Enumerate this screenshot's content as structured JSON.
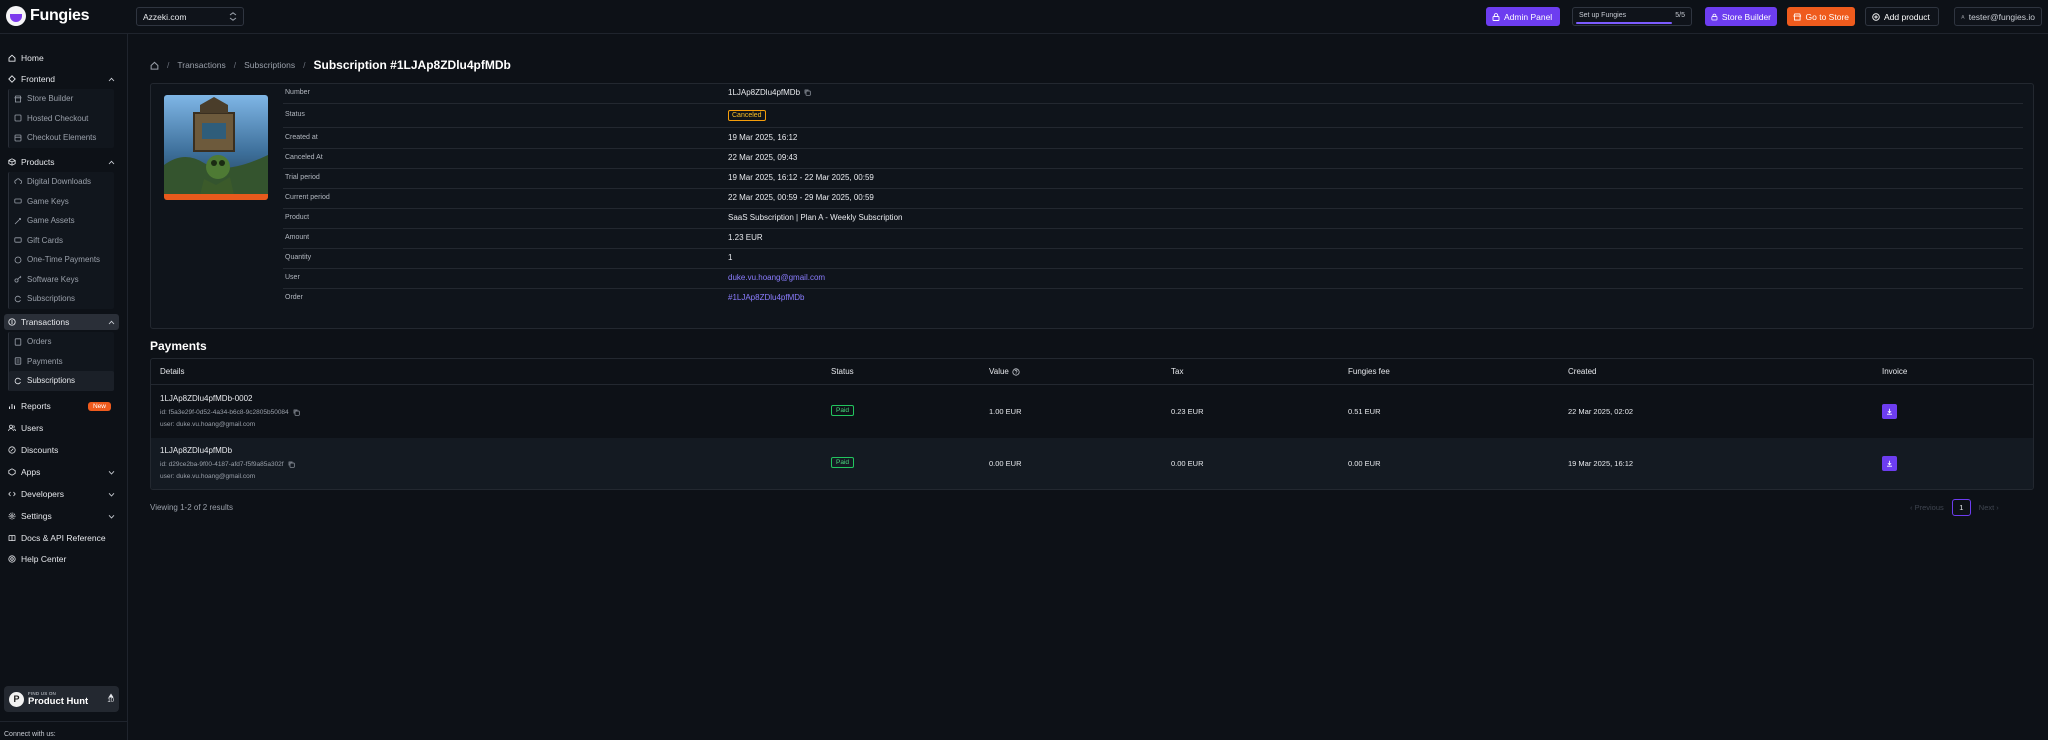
{
  "brand": {
    "name": "Fungies"
  },
  "topbar": {
    "store": "Azzeki.com",
    "admin_panel": "Admin Panel",
    "setup_label": "Set up Fungies",
    "setup_count": "5/5",
    "setup_progress": 1.0,
    "store_builder": "Store Builder",
    "go_to_store": "Go to Store",
    "add_product": "Add product",
    "user_email": "tester@fungies.io"
  },
  "sidebar": {
    "home": "Home",
    "frontend": "Frontend",
    "frontend_items": [
      "Store Builder",
      "Hosted Checkout",
      "Checkout Elements"
    ],
    "products": "Products",
    "products_items": [
      "Digital Downloads",
      "Game Keys",
      "Game Assets",
      "Gift Cards",
      "One-Time Payments",
      "Software Keys",
      "Subscriptions"
    ],
    "transactions": "Transactions",
    "transactions_items": [
      "Orders",
      "Payments",
      "Subscriptions"
    ],
    "reports": "Reports",
    "reports_badge": "New",
    "users": "Users",
    "discounts": "Discounts",
    "apps": "Apps",
    "developers": "Developers",
    "settings": "Settings",
    "docs": "Docs & API Reference",
    "help": "Help Center",
    "ph_small": "FIND US ON",
    "ph_big": "Product Hunt",
    "ph_count": "10",
    "connect": "Connect with us:"
  },
  "breadcrumb": {
    "transactions": "Transactions",
    "subscriptions": "Subscriptions",
    "title": "Subscription #1LJAp8ZDlu4pfMDb"
  },
  "details": {
    "number_label": "Number",
    "number": "1LJAp8ZDlu4pfMDb",
    "status_label": "Status",
    "status": "Canceled",
    "created_label": "Created at",
    "created": "19 Mar 2025, 16:12",
    "canceled_label": "Canceled At",
    "canceled": "22 Mar 2025, 09:43",
    "trial_label": "Trial period",
    "trial": "19 Mar 2025, 16:12 - 22 Mar 2025, 00:59",
    "current_label": "Current period",
    "current": "22 Mar 2025, 00:59 - 29 Mar 2025, 00:59",
    "product_label": "Product",
    "product": "SaaS Subscription | Plan A - Weekly Subscription",
    "amount_label": "Amount",
    "amount": "1.23 EUR",
    "quantity_label": "Quantity",
    "quantity": "1",
    "user_label": "User",
    "user": "duke.vu.hoang@gmail.com",
    "order_label": "Order",
    "order": "#1LJAp8ZDlu4pfMDb"
  },
  "payments": {
    "title": "Payments",
    "headers": {
      "details": "Details",
      "status": "Status",
      "value": "Value",
      "tax": "Tax",
      "fee": "Fungies fee",
      "created": "Created",
      "invoice": "Invoice"
    },
    "rows": [
      {
        "name": "1LJAp8ZDlu4pfMDb-0002",
        "id": "id: f5a3e29f-0d52-4a34-b6c8-9c2805b50084",
        "user": "user: duke.vu.hoang@gmail.com",
        "status": "Paid",
        "value": "1.00 EUR",
        "tax": "0.23 EUR",
        "fee": "0.51 EUR",
        "created": "22 Mar 2025, 02:02"
      },
      {
        "name": "1LJAp8ZDlu4pfMDb",
        "id": "id: d29ce2ba-9f00-4187-afd7-f5f9a85a302f",
        "user": "user: duke.vu.hoang@gmail.com",
        "status": "Paid",
        "value": "0.00 EUR",
        "tax": "0.00 EUR",
        "fee": "0.00 EUR",
        "created": "19 Mar 2025, 16:12"
      }
    ],
    "viewing": "Viewing 1-2 of 2 results",
    "prev": "Previous",
    "page": "1",
    "next": "Next"
  },
  "colors": {
    "accent": "#6d3df0",
    "orange": "#ef5b1d",
    "paid": "#22c55e",
    "canceled": "#f59e0b",
    "link": "#8b7dff"
  }
}
